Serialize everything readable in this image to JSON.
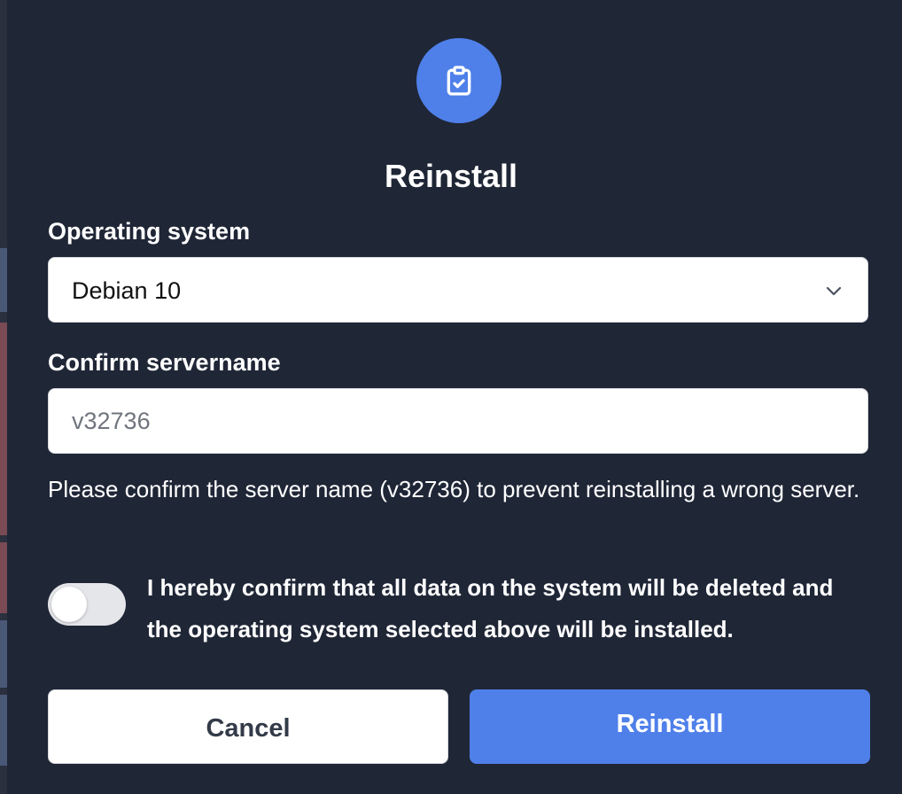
{
  "dialog": {
    "icon": "clipboard-check-icon",
    "title": "Reinstall"
  },
  "os_field": {
    "label": "Operating system",
    "selected": "Debian 10",
    "chevron_icon": "chevron-down-icon"
  },
  "servername_field": {
    "label": "Confirm servername",
    "placeholder": "v32736",
    "value": "",
    "help": "Please confirm the server name (v32736) to prevent reinstalling a wrong server."
  },
  "confirm_toggle": {
    "checked": false,
    "text": "I hereby confirm that all data on the system will be deleted and the operating system selected above will be installed."
  },
  "buttons": {
    "cancel": "Cancel",
    "reinstall": "Reinstall"
  },
  "colors": {
    "background": "#1f2636",
    "accent": "#4f80ea",
    "text": "#ffffff",
    "toggle_track": "#e5e6ea"
  }
}
